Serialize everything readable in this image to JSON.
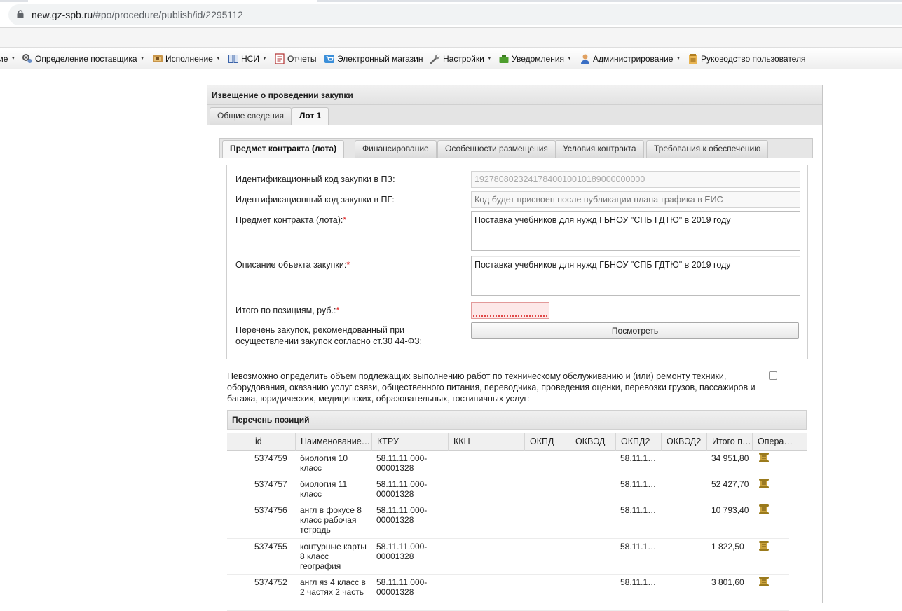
{
  "browser": {
    "url_host": "new.gz-spb.ru",
    "url_path": "/#po/procedure/publish/id/2295112"
  },
  "menu": {
    "items": [
      {
        "label": "ие",
        "dropdown": true,
        "icon": "none"
      },
      {
        "label": "Определение поставщика",
        "dropdown": true,
        "icon": "people-gear-icon"
      },
      {
        "label": "Исполнение",
        "dropdown": true,
        "icon": "handshake-icon"
      },
      {
        "label": "НСИ",
        "dropdown": true,
        "icon": "book-icon"
      },
      {
        "label": "Отчеты",
        "dropdown": false,
        "icon": "report-icon"
      },
      {
        "label": "Электронный магазин",
        "dropdown": false,
        "icon": "cart-icon"
      },
      {
        "label": "Настройки",
        "dropdown": true,
        "icon": "wrench-icon"
      },
      {
        "label": "Уведомления",
        "dropdown": true,
        "icon": "notification-icon"
      },
      {
        "label": "Администрирование",
        "dropdown": true,
        "icon": "admin-user-icon"
      },
      {
        "label": "Руководство пользователя",
        "dropdown": false,
        "icon": "manual-icon"
      }
    ]
  },
  "window": {
    "title": "Извещение о проведении закупки",
    "tabs": [
      "Общие сведения",
      "Лот 1"
    ],
    "active_tab": 1
  },
  "lot": {
    "tabs": [
      "Предмет контракта (лота)",
      "Финансирование",
      "Особенности размещения",
      "Условия контракта",
      "Требования к обеспечению"
    ],
    "active_tab": 0,
    "fields": {
      "pz_code_label": "Идентификационный код закупки в ПЗ:",
      "pz_code_value": "19278080232417840010010189000000000",
      "pg_code_label": "Идентификационный код закупки в ПГ:",
      "pg_code_placeholder": "Код будет присвоен после публикации плана-графика в ЕИС",
      "subject_label": "Предмет контракта (лота):",
      "subject_value": "Поставка учебников для нужд ГБНОУ \"СПБ ГДТЮ\" в 2019 году",
      "description_label": "Описание объекта закупки:",
      "description_value": "Поставка учебников для нужд ГБНОУ \"СПБ ГДТЮ\" в 2019 году",
      "total_label": "Итого по позициям, руб.:",
      "total_value": "",
      "recommended_label": "Перечень закупок, рекомендованный при осуществлении закупок согласно ст.30 44-ФЗ:",
      "view_button": "Посмотреть",
      "required_mark": "*"
    },
    "note": "Невозможно определить объем подлежащих выполнению работ по техническому обслуживанию и (или) ремонту техники, оборудования, оказанию услуг связи, общественного питания, переводчика, проведения оценки, перевозки грузов, пассажиров и багажа, юридических, медицинских, образовательных, гостиничных услуг:",
    "note_checked": false
  },
  "positions": {
    "title": "Перечень позиций",
    "columns": [
      "id",
      "Наименование…",
      "КТРУ",
      "ККН",
      "ОКПД",
      "ОКВЭД",
      "ОКПД2",
      "ОКВЭД2",
      "Итого п…",
      "Опера…"
    ],
    "rows": [
      {
        "id": "5374759",
        "name": "биология 10 класс",
        "ktru": "58.11.11.000-00001328",
        "okpd2": "58.11.1…",
        "total": "34 951,80"
      },
      {
        "id": "5374757",
        "name": "биология 11 класс",
        "ktru": "58.11.11.000-00001328",
        "okpd2": "58.11.1…",
        "total": "52 427,70"
      },
      {
        "id": "5374756",
        "name": "англ в фокусе 8 класс рабочая тетрадь",
        "ktru": "58.11.11.000-00001328",
        "okpd2": "58.11.1…",
        "total": "10 793,40"
      },
      {
        "id": "5374755",
        "name": "контурные карты 8 класс география",
        "ktru": "58.11.11.000-00001328",
        "okpd2": "58.11.1…",
        "total": "1 822,50"
      },
      {
        "id": "5374752",
        "name": "англ яз 4 класс в 2 частях 2 часть",
        "ktru": "58.11.11.000-00001328",
        "okpd2": "58.11.1…",
        "total": "3 801,60"
      }
    ]
  },
  "colors": {
    "required": "#e02020",
    "error_bg": "#fde8e8",
    "header_bg": "#e2e2e2"
  }
}
